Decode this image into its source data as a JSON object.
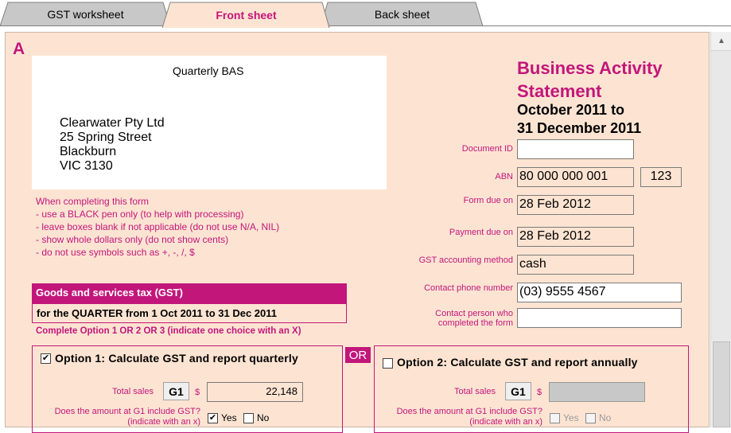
{
  "tabs": [
    {
      "label": "GST worksheet",
      "active": false
    },
    {
      "label": "Front sheet",
      "active": true
    },
    {
      "label": "Back sheet",
      "active": false
    }
  ],
  "section_letter": "A",
  "address": {
    "title": "Quarterly BAS",
    "lines": [
      "Clearwater Pty Ltd",
      "25 Spring Street",
      "Blackburn",
      "VIC 3130"
    ]
  },
  "instructions": [
    "When completing this form",
    "- use a BLACK pen only (to help with processing)",
    "- leave boxes blank if not applicable (do not use N/A, NIL)",
    "- show whole dollars only (do not show cents)",
    "- do not use symbols such as +, -, /, $"
  ],
  "statement": {
    "title_line1": "Business Activity",
    "title_line2": "Statement",
    "period_line1": "October 2011 to",
    "period_line2": "31 December 2011"
  },
  "fields": {
    "document_id": {
      "label": "Document ID",
      "value": ""
    },
    "abn": {
      "label": "ABN",
      "value": "80 000 000 001",
      "branch": "123"
    },
    "form_due": {
      "label": "Form due on",
      "value": "28 Feb 2012"
    },
    "payment_due": {
      "label": "Payment due on",
      "value": "28 Feb 2012"
    },
    "gst_method": {
      "label": "GST accounting method",
      "value": "cash"
    },
    "phone": {
      "label": "Contact phone number",
      "value": "(03) 9555 4567"
    },
    "contact_person": {
      "label_line1": "Contact person who",
      "label_line2": "completed the form",
      "value": ""
    }
  },
  "gst": {
    "heading": "Goods and services tax (GST)",
    "quarter": "for the QUARTER from 1 Oct 2011 to 31 Dec 2011",
    "option_note": "Complete Option 1 OR 2 OR 3 (indicate one choice with an X)",
    "or_label": "OR"
  },
  "option1": {
    "checked": true,
    "title": "Option 1: Calculate GST and report quarterly",
    "total_sales_label": "Total sales",
    "g1_label": "G1",
    "dollar": "$",
    "total_sales_value": "22,148",
    "include_gst_q1": "Does the amount at G1 include GST?",
    "include_gst_q2": "(indicate with an x)",
    "yes_label": "Yes",
    "no_label": "No",
    "yes_checked": true,
    "no_checked": false
  },
  "option2": {
    "checked": false,
    "title": "Option 2: Calculate GST and report annually",
    "total_sales_label": "Total sales",
    "g1_label": "G1",
    "dollar": "$",
    "total_sales_value": "",
    "include_gst_q1": "Does the amount at G1 include GST?",
    "include_gst_q2": "(indicate with an x)",
    "yes_label": "Yes",
    "no_label": "No",
    "yes_checked": false,
    "no_checked": false
  },
  "colors": {
    "accent": "#c2167b",
    "panel_bg": "#fde4d2",
    "active_tab_bg": "#fde4d2",
    "inactive_tab_bg": "#c8c8c8"
  }
}
